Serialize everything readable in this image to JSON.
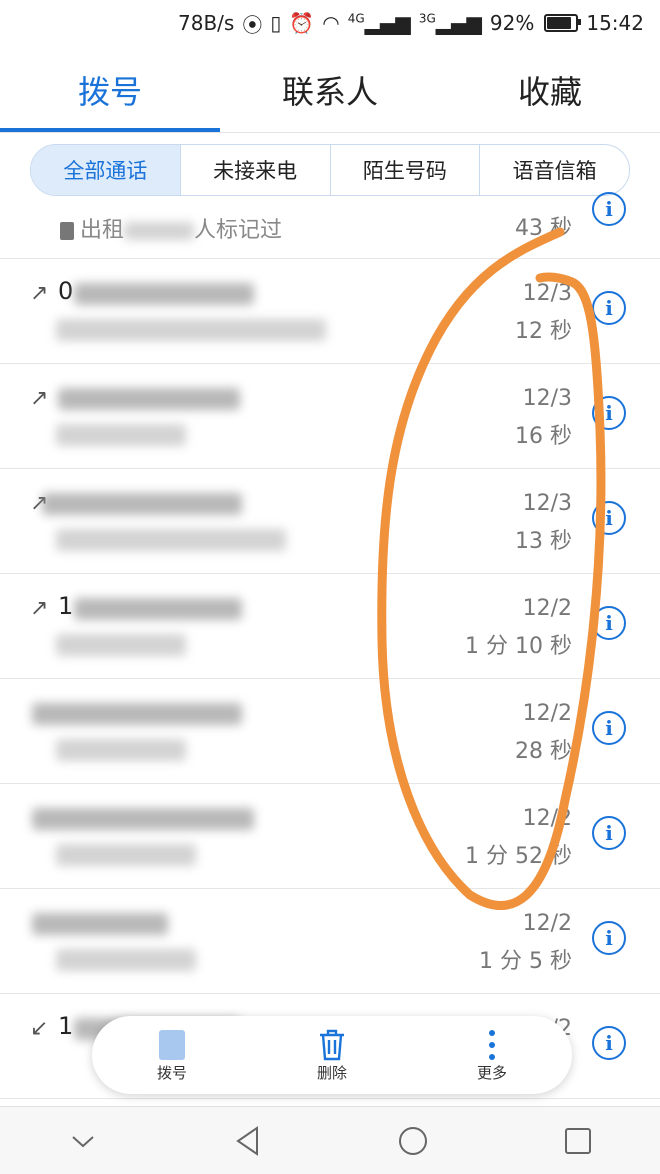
{
  "status_bar": {
    "net_speed": "78B/s",
    "signal_1_label": "4G",
    "signal_2_label": "3G",
    "battery": "92%",
    "battery_level": 0.92,
    "time": "15:42"
  },
  "tabs": [
    {
      "label": "拨号",
      "active": true
    },
    {
      "label": "联系人",
      "active": false
    },
    {
      "label": "收藏",
      "active": false
    }
  ],
  "filters": [
    {
      "label": "全部通话",
      "active": true
    },
    {
      "label": "未接来电",
      "active": false
    },
    {
      "label": "陌生号码",
      "active": false
    },
    {
      "label": "语音信箱",
      "active": false
    }
  ],
  "partial_row": {
    "note_prefix": "出租",
    "note_suffix": "人标记过",
    "duration": "43 秒"
  },
  "calls": [
    {
      "number_start": "0",
      "date": "12/3",
      "duration": "12 秒"
    },
    {
      "number_start": "",
      "date": "12/3",
      "duration": "16 秒"
    },
    {
      "number_start": "",
      "date": "12/3",
      "duration": "13 秒"
    },
    {
      "number_start": "1",
      "date": "12/2",
      "duration": "1 分 10 秒"
    },
    {
      "number_start": "",
      "date": "12/2",
      "duration": "28 秒"
    },
    {
      "number_start": "",
      "date": "12/2",
      "duration": "1 分 52 秒"
    },
    {
      "number_start": "",
      "date": "12/2",
      "duration": "1 分 5 秒"
    },
    {
      "number_start": "1",
      "date": "12/2",
      "duration": ""
    }
  ],
  "actions": [
    {
      "label": "拨号",
      "icon": "dialpad-icon"
    },
    {
      "label": "删除",
      "icon": "trash-icon"
    },
    {
      "label": "更多",
      "icon": "more-vertical-icon"
    }
  ],
  "colors": {
    "accent": "#1a73d9",
    "annotation": "#f0913c"
  }
}
